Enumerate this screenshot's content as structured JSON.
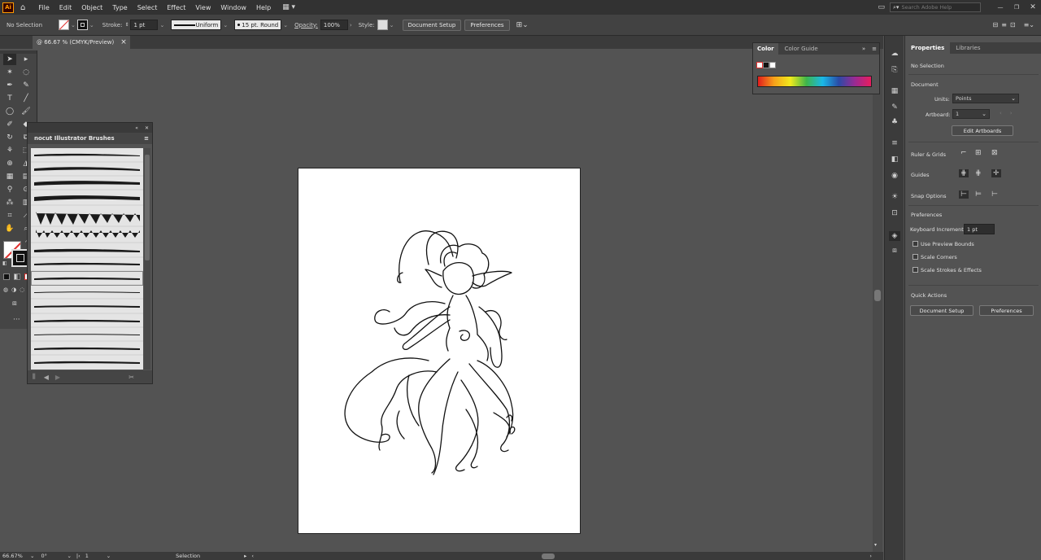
{
  "app": {
    "logo": "Ai",
    "accent": "#ff9a00"
  },
  "menu": [
    "File",
    "Edit",
    "Object",
    "Type",
    "Select",
    "Effect",
    "View",
    "Window",
    "Help"
  ],
  "search": {
    "placeholder": "Search Adobe Help"
  },
  "control": {
    "selection": "No Selection",
    "stroke_label": "Stroke:",
    "stroke_value": "1 pt",
    "profile": "Uniform",
    "brush": "15 pt. Round",
    "opacity_label": "Opacity:",
    "opacity_value": "100%",
    "style_label": "Style:",
    "document_setup": "Document Setup",
    "preferences": "Preferences"
  },
  "doc_tab": {
    "title": "@ 66.67 % (CMYK/Preview)",
    "close": "×"
  },
  "brushes_panel": {
    "title": "nocut Illustrator Brushes"
  },
  "color_panel": {
    "tabs": [
      "Color",
      "Color Guide"
    ]
  },
  "properties": {
    "tabs": [
      "Properties",
      "Libraries"
    ],
    "selection": "No Selection",
    "document_heading": "Document",
    "units_label": "Units:",
    "units_value": "Points",
    "artboard_label": "Artboard:",
    "artboard_value": "1",
    "edit_artboards": "Edit Artboards",
    "ruler_grids": "Ruler & Grids",
    "guides": "Guides",
    "snap_options": "Snap Options",
    "preferences_heading": "Preferences",
    "keyboard_increment_label": "Keyboard Increment:",
    "keyboard_increment_value": "1 pt",
    "use_preview_bounds": "Use Preview Bounds",
    "scale_corners": "Scale Corners",
    "scale_strokes": "Scale Strokes & Effects",
    "quick_actions": "Quick Actions",
    "qa_document_setup": "Document Setup",
    "qa_preferences": "Preferences"
  },
  "status": {
    "zoom": "66.67%",
    "rotation": "0°",
    "artboard": "1",
    "tool": "Selection"
  }
}
